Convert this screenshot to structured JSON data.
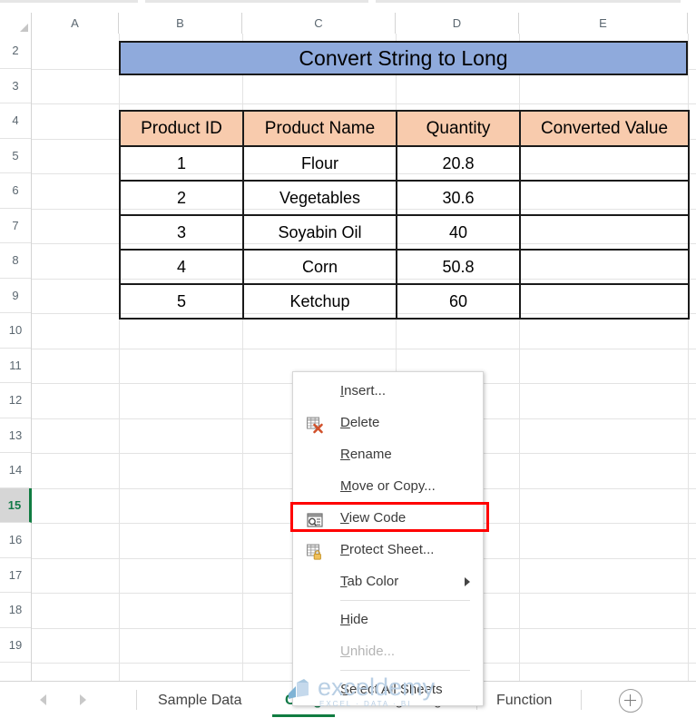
{
  "spreadsheet": {
    "columns": [
      "A",
      "B",
      "C",
      "D",
      "E"
    ],
    "rows": [
      "2",
      "3",
      "4",
      "5",
      "6",
      "7",
      "8",
      "9",
      "10",
      "11",
      "12",
      "13",
      "14",
      "15",
      "16",
      "17",
      "18",
      "19"
    ],
    "active_row": "15",
    "title_banner": "Convert String to Long",
    "colors": {
      "title_background": "#8FAADC",
      "header_background": "#F8CBAD",
      "active_tab": "#107C41",
      "highlight_box": "#FF0000"
    }
  },
  "table": {
    "headers": [
      "Product ID",
      "Product Name",
      "Quantity",
      "Converted Value"
    ],
    "rows": [
      {
        "product_id": "1",
        "product_name": "Flour",
        "quantity": "20.8",
        "converted_value": ""
      },
      {
        "product_id": "2",
        "product_name": "Vegetables",
        "quantity": "30.6",
        "converted_value": ""
      },
      {
        "product_id": "3",
        "product_name": "Soyabin Oil",
        "quantity": "40",
        "converted_value": ""
      },
      {
        "product_id": "4",
        "product_name": "Corn",
        "quantity": "50.8",
        "converted_value": ""
      },
      {
        "product_id": "5",
        "product_name": "Ketchup",
        "quantity": "60",
        "converted_value": ""
      }
    ]
  },
  "context_menu": {
    "items": [
      {
        "label": "Insert...",
        "accel": "I",
        "icon": "",
        "disabled": false,
        "submenu": false
      },
      {
        "label": "Delete",
        "accel": "D",
        "icon": "delete-sheet-icon",
        "disabled": false,
        "submenu": false
      },
      {
        "label": "Rename",
        "accel": "R",
        "icon": "",
        "disabled": false,
        "submenu": false
      },
      {
        "label": "Move or Copy...",
        "accel": "M",
        "icon": "",
        "disabled": false,
        "submenu": false
      },
      {
        "label": "View Code",
        "accel": "V",
        "icon": "view-code-icon",
        "disabled": false,
        "submenu": false
      },
      {
        "label": "Protect Sheet...",
        "accel": "P",
        "icon": "protect-sheet-icon",
        "disabled": false,
        "submenu": false
      },
      {
        "label": "Tab Color",
        "accel": "T",
        "icon": "",
        "disabled": false,
        "submenu": true
      },
      {
        "label": "Hide",
        "accel": "H",
        "icon": "",
        "disabled": false,
        "submenu": false
      },
      {
        "label": "Unhide...",
        "accel": "U",
        "icon": "",
        "disabled": true,
        "submenu": false
      },
      {
        "label": "Select All Sheets",
        "accel": "S",
        "icon": "",
        "disabled": false,
        "submenu": false
      }
    ],
    "highlighted_item": "View Code"
  },
  "sheet_bar": {
    "tabs": [
      {
        "name": "Sample Data",
        "active": false
      },
      {
        "name": "CLng",
        "active": true
      },
      {
        "name": "CLng Range",
        "active": false
      },
      {
        "name": "Function",
        "active": false
      }
    ],
    "add_sheet_label": "+"
  },
  "watermark": {
    "brand": "exceldemy",
    "tagline": "EXCEL · DATA · BI"
  }
}
